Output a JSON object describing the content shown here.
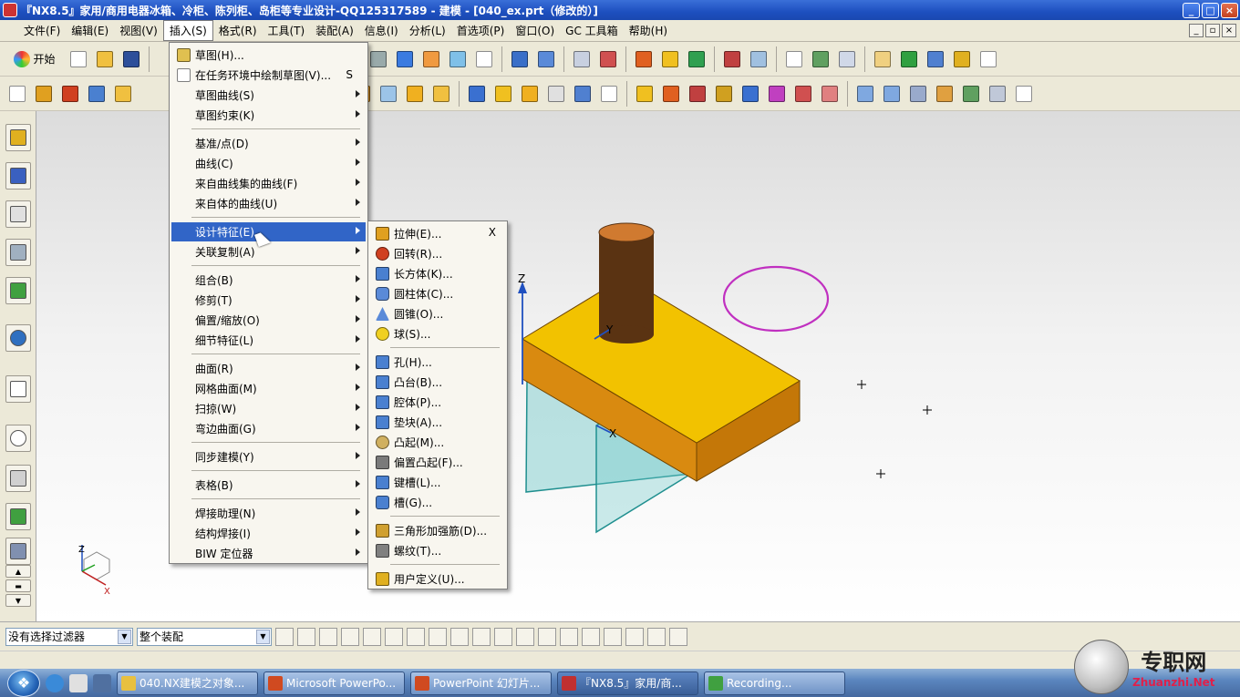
{
  "window": {
    "title": "『NX8.5』家用/商用电器冰箱、冷柜、陈列柜、岛柜等专业设计-QQ125317589 - 建模 - [040_ex.prt（修改的）]"
  },
  "menubar": {
    "items": [
      "文件(F)",
      "编辑(E)",
      "视图(V)",
      "插入(S)",
      "格式(R)",
      "工具(T)",
      "装配(A)",
      "信息(I)",
      "分析(L)",
      "首选项(P)",
      "窗口(O)",
      "GC 工具箱",
      "帮助(H)"
    ],
    "active_index": 3
  },
  "toolbar": {
    "start_label": "开始"
  },
  "insert_menu": {
    "items": [
      {
        "label": "草图(H)...",
        "submenu": false,
        "icon": "sketch-icon"
      },
      {
        "label": "在任务环境中绘制草图(V)...",
        "submenu": false,
        "accel": "S",
        "icon": "sketch-task-icon"
      },
      {
        "label": "草图曲线(S)",
        "submenu": true
      },
      {
        "label": "草图约束(K)",
        "submenu": true
      },
      {
        "label": "基准/点(D)",
        "submenu": true
      },
      {
        "label": "曲线(C)",
        "submenu": true
      },
      {
        "label": "来自曲线集的曲线(F)",
        "submenu": true
      },
      {
        "label": "来自体的曲线(U)",
        "submenu": true
      },
      {
        "label": "设计特征(E)",
        "submenu": true,
        "highlighted": true
      },
      {
        "label": "关联复制(A)",
        "submenu": true
      },
      {
        "label": "组合(B)",
        "submenu": true
      },
      {
        "label": "修剪(T)",
        "submenu": true
      },
      {
        "label": "偏置/缩放(O)",
        "submenu": true
      },
      {
        "label": "细节特征(L)",
        "submenu": true
      },
      {
        "label": "曲面(R)",
        "submenu": true
      },
      {
        "label": "网格曲面(M)",
        "submenu": true
      },
      {
        "label": "扫掠(W)",
        "submenu": true
      },
      {
        "label": "弯边曲面(G)",
        "submenu": true
      },
      {
        "label": "同步建模(Y)",
        "submenu": true
      },
      {
        "label": "表格(B)",
        "submenu": true
      },
      {
        "label": "焊接助理(N)",
        "submenu": true
      },
      {
        "label": "结构焊接(I)",
        "submenu": true
      },
      {
        "label": "BIW 定位器",
        "submenu": true
      }
    ]
  },
  "feature_submenu": {
    "close_label": "X",
    "items": [
      {
        "label": "拉伸(E)...",
        "icon": "extrude-icon",
        "color": "#e0a020"
      },
      {
        "label": "回转(R)...",
        "icon": "revolve-icon",
        "color": "#d04020"
      },
      {
        "label": "长方体(K)...",
        "icon": "block-icon",
        "color": "#4a80d0"
      },
      {
        "label": "圆柱体(C)...",
        "icon": "cylinder-icon",
        "color": "#5a8ad8"
      },
      {
        "label": "圆锥(O)...",
        "icon": "cone-icon",
        "color": "#5a8ad8"
      },
      {
        "label": "球(S)...",
        "icon": "sphere-icon",
        "color": "#f0d020"
      },
      {
        "label": "孔(H)...",
        "icon": "hole-icon",
        "color": "#4a80d0"
      },
      {
        "label": "凸台(B)...",
        "icon": "boss-icon",
        "color": "#4a80d0"
      },
      {
        "label": "腔体(P)...",
        "icon": "pocket-icon",
        "color": "#4a80d0"
      },
      {
        "label": "垫块(A)...",
        "icon": "pad-icon",
        "color": "#4a80d0"
      },
      {
        "label": "凸起(M)...",
        "icon": "emboss-icon",
        "color": "#d0b060"
      },
      {
        "label": "偏置凸起(F)...",
        "icon": "offset-emboss-icon",
        "color": "#7a7a7a"
      },
      {
        "label": "键槽(L)...",
        "icon": "slot-icon",
        "color": "#4a80d0"
      },
      {
        "label": "槽(G)...",
        "icon": "groove-icon",
        "color": "#4a80d0"
      },
      {
        "label": "三角形加强筋(D)...",
        "icon": "dart-icon",
        "color": "#d0a030"
      },
      {
        "label": "螺纹(T)...",
        "icon": "thread-icon",
        "color": "#808080"
      },
      {
        "label": "用户定义(U)...",
        "icon": "user-defined-icon",
        "color": "#e0b020"
      }
    ]
  },
  "viewport": {
    "axis_labels": {
      "z": "Z",
      "y": "Y",
      "x": "X"
    }
  },
  "statusbar": {
    "filter": "没有选择过滤器",
    "scope": "整个装配"
  },
  "taskbar": {
    "tasks": [
      {
        "label": "040.NX建模之对象...",
        "icon": "folder-icon",
        "color": "#e8c040"
      },
      {
        "label": "Microsoft PowerPo...",
        "icon": "powerpoint-icon",
        "color": "#d04a20"
      },
      {
        "label": "PowerPoint 幻灯片...",
        "icon": "slideshow-icon",
        "color": "#d04a20"
      },
      {
        "label": "『NX8.5』家用/商...",
        "icon": "nx-icon",
        "color": "#c03030",
        "active": true
      },
      {
        "label": "Recording...",
        "icon": "recording-icon",
        "color": "#40a040"
      }
    ]
  },
  "watermark": {
    "brand": "专职网",
    "url": "Zhuanzhi.Net"
  },
  "colors": {
    "accent": "#3165c7",
    "block_top": "#f2c200",
    "block_side": "#d98a10",
    "cylinder": "#5a3312",
    "circle": "#c030c0",
    "datum_plane": "#6ec8c8"
  }
}
